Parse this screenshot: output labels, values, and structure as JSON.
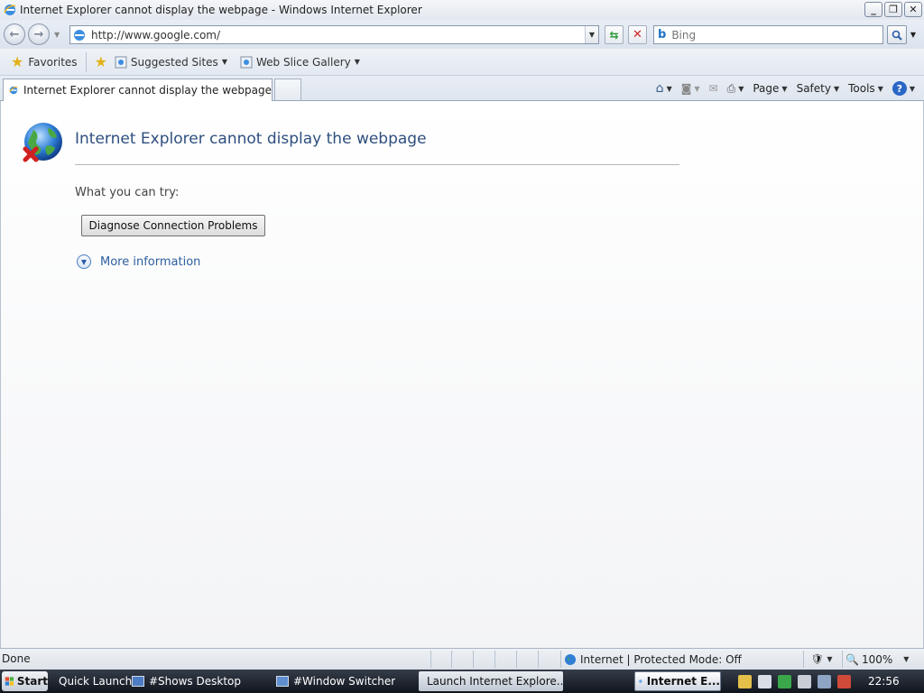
{
  "window": {
    "title": "Internet Explorer cannot display the webpage - Windows Internet Explorer",
    "controls": {
      "minimize": "_",
      "maximize": "❐",
      "close": "✕"
    }
  },
  "address_bar": {
    "url": "http://www.google.com/",
    "search_placeholder": "Bing"
  },
  "favorites_bar": {
    "favorites_label": "Favorites",
    "items": [
      {
        "label": "Suggested Sites"
      },
      {
        "label": "Web Slice Gallery"
      }
    ]
  },
  "tabs": {
    "active_label": "Internet Explorer cannot display the webpage"
  },
  "command_bar": {
    "page_label": "Page",
    "safety_label": "Safety",
    "tools_label": "Tools",
    "help_glyph": "?"
  },
  "content": {
    "title": "Internet Explorer cannot display the webpage",
    "try_label": "What you can try:",
    "diagnose_button": "Diagnose Connection Problems",
    "more_info": "More information"
  },
  "status_bar": {
    "status": "Done",
    "zone": "Internet | Protected Mode: Off",
    "zoom": "100%"
  },
  "taskbar": {
    "start": "Start",
    "quick_launch": "Quick Launch",
    "items": [
      {
        "label": "#Shows Desktop"
      },
      {
        "label": "#Window Switcher"
      },
      {
        "label": "Launch Internet Explore..."
      },
      {
        "label": "Internet E..."
      }
    ],
    "clock": "22:56"
  },
  "colors": {
    "accent": "#2e4f7e",
    "link": "#2e5e9e",
    "error_red": "#cc2222"
  }
}
